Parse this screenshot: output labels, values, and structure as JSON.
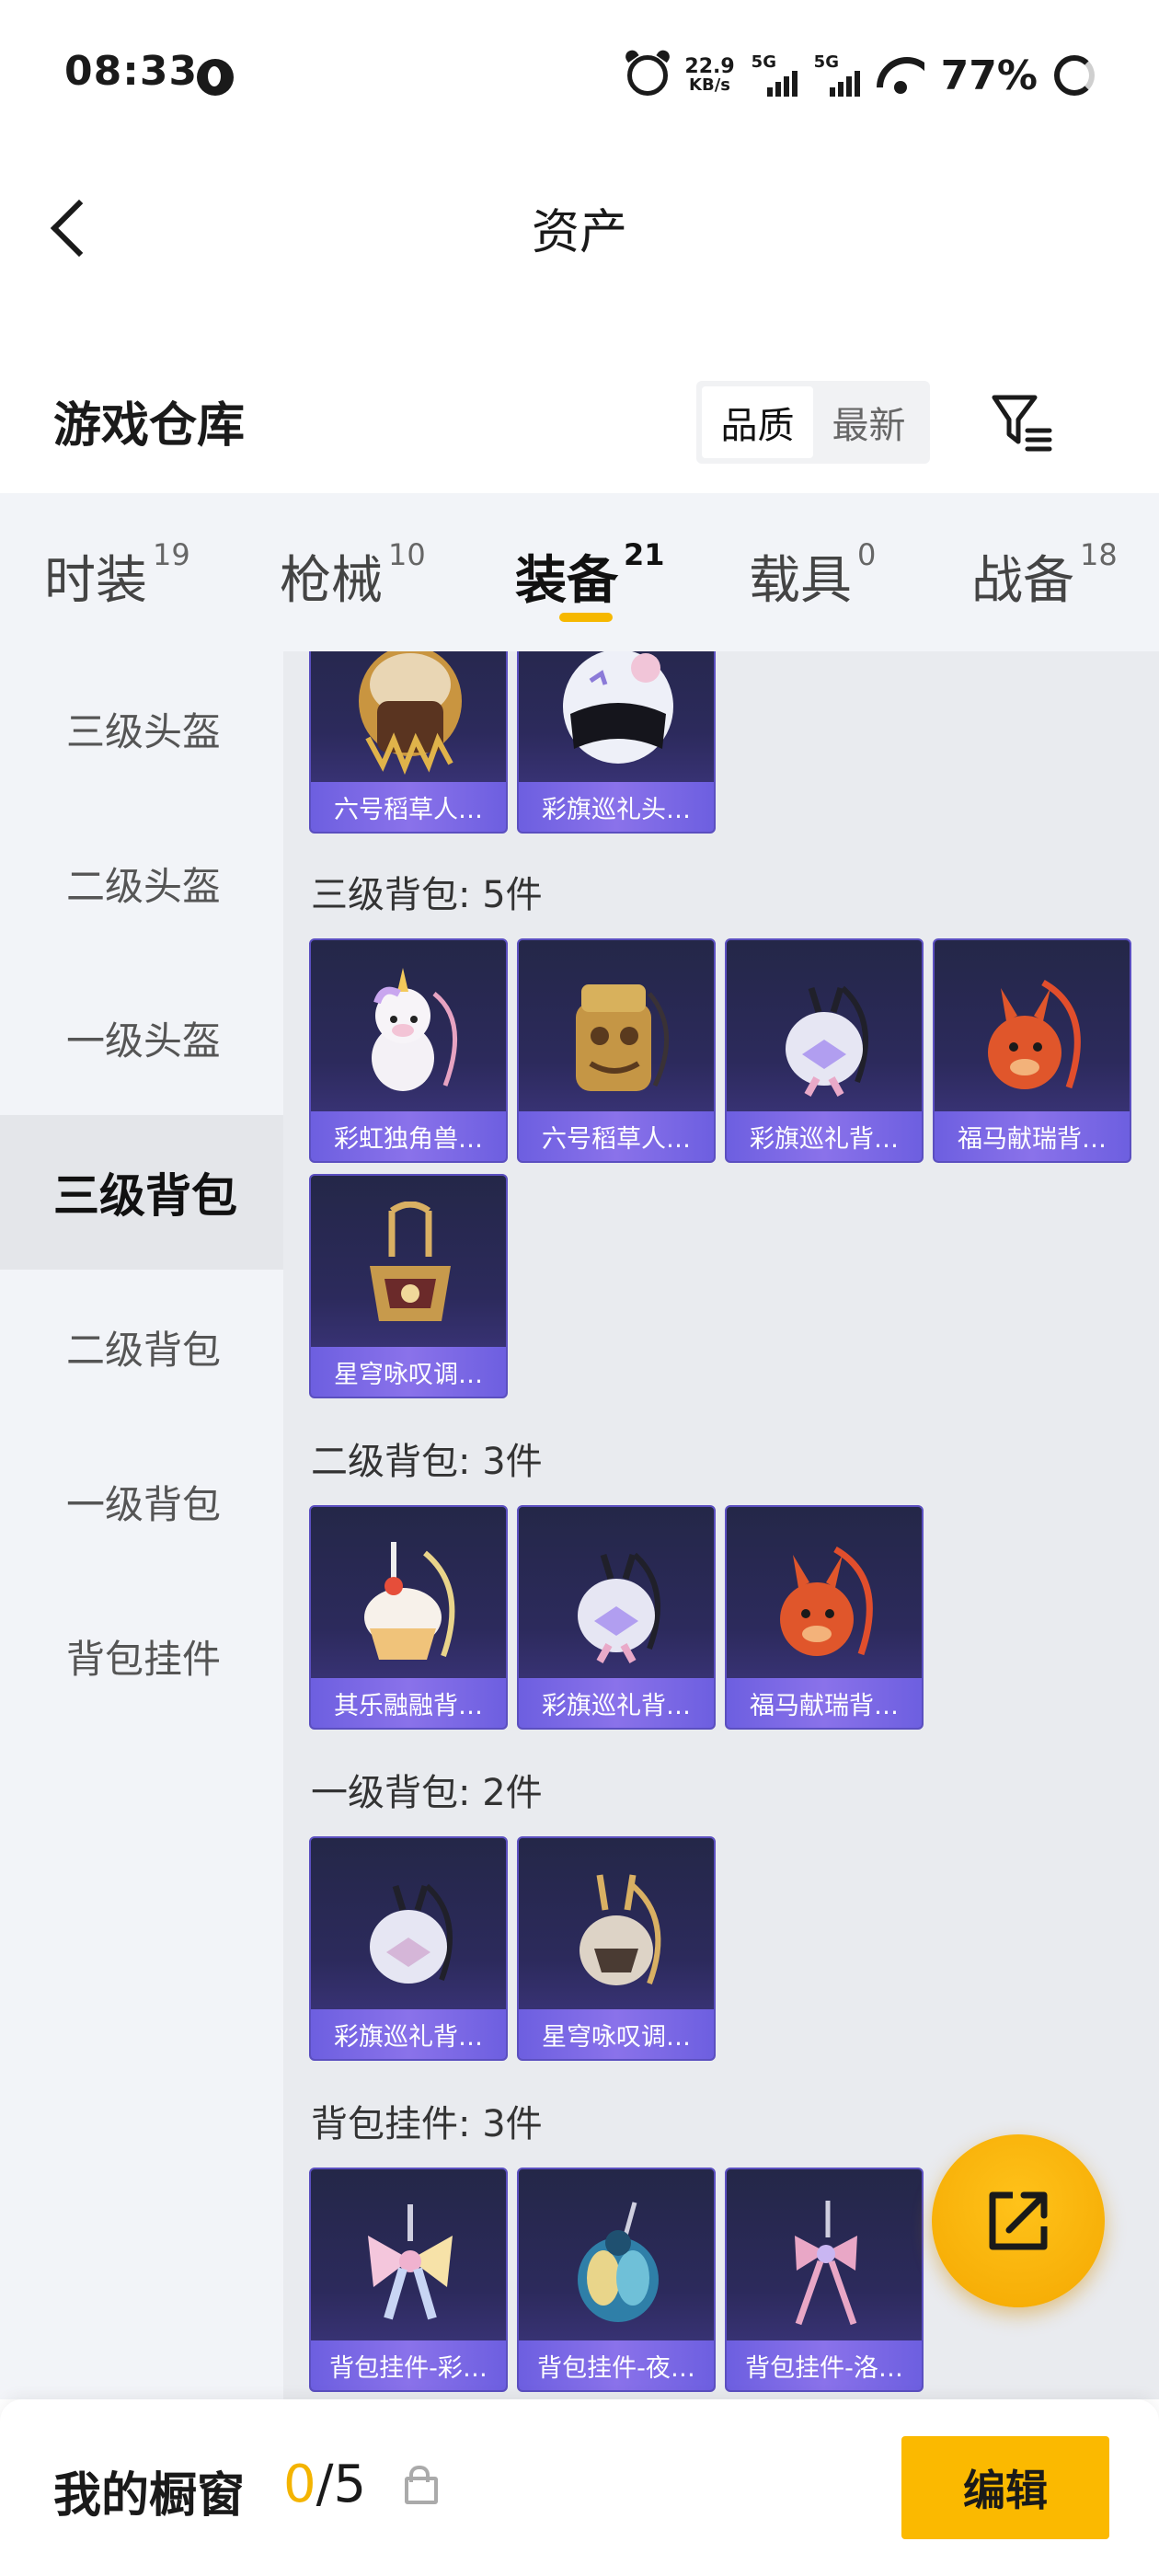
{
  "status_bar": {
    "time": "08:33",
    "net_speed_value": "22.9",
    "net_speed_unit": "KB/s",
    "sim1_label": "5G",
    "sim2_label": "5G",
    "battery": "77%"
  },
  "header": {
    "title": "资产"
  },
  "section": {
    "title": "游戏仓库",
    "sort_options": [
      {
        "label": "品质",
        "active": true
      },
      {
        "label": "最新",
        "active": false
      }
    ]
  },
  "tabs": [
    {
      "name": "时装",
      "count": "19",
      "active": false
    },
    {
      "name": "枪械",
      "count": "10",
      "active": false
    },
    {
      "name": "装备",
      "count": "21",
      "active": true
    },
    {
      "name": "载具",
      "count": "0",
      "active": false
    },
    {
      "name": "战备",
      "count": "18",
      "active": false
    }
  ],
  "sidebar": [
    {
      "label": "三级头盔",
      "active": false
    },
    {
      "label": "二级头盔",
      "active": false
    },
    {
      "label": "一级头盔",
      "active": false
    },
    {
      "label": "三级背包",
      "active": true
    },
    {
      "label": "二级背包",
      "active": false
    },
    {
      "label": "一级背包",
      "active": false
    },
    {
      "label": "背包挂件",
      "active": false
    }
  ],
  "content": {
    "top_items": [
      {
        "name": "六号稻草人…",
        "icon": "helmet-straw-icon"
      },
      {
        "name": "彩旗巡礼头…",
        "icon": "helmet-white-icon"
      }
    ],
    "groups": [
      {
        "label": "三级背包: 5件",
        "items": [
          {
            "name": "彩虹独角兽…",
            "icon": "unicorn-backpack-icon"
          },
          {
            "name": "六号稻草人…",
            "icon": "straw-backpack-icon"
          },
          {
            "name": "彩旗巡礼背…",
            "icon": "parade-backpack-icon"
          },
          {
            "name": "福马献瑞背…",
            "icon": "horse-backpack-icon"
          },
          {
            "name": "星穹咏叹调…",
            "icon": "star-backpack-icon"
          }
        ]
      },
      {
        "label": "二级背包: 3件",
        "items": [
          {
            "name": "其乐融融背…",
            "icon": "cake-backpack-icon"
          },
          {
            "name": "彩旗巡礼背…",
            "icon": "parade-backpack-icon"
          },
          {
            "name": "福马献瑞背…",
            "icon": "horse-backpack-icon"
          }
        ]
      },
      {
        "label": "一级背包: 2件",
        "items": [
          {
            "name": "彩旗巡礼背…",
            "icon": "parade-backpack-icon"
          },
          {
            "name": "星穹咏叹调…",
            "icon": "star-backpack-icon"
          }
        ]
      },
      {
        "label": "背包挂件: 3件",
        "items": [
          {
            "name": "背包挂件-彩…",
            "icon": "bow-charm-icon"
          },
          {
            "name": "背包挂件-夜…",
            "icon": "beetle-charm-icon"
          },
          {
            "name": "背包挂件-洛…",
            "icon": "ribbon-charm-icon"
          }
        ]
      }
    ]
  },
  "showcase": {
    "title": "我的橱窗",
    "current": "0",
    "total": "/5",
    "edit_label": "编辑"
  },
  "colors": {
    "accent": "#f6b800",
    "card_top": "#242748",
    "card_caption": "#7a68e6"
  }
}
